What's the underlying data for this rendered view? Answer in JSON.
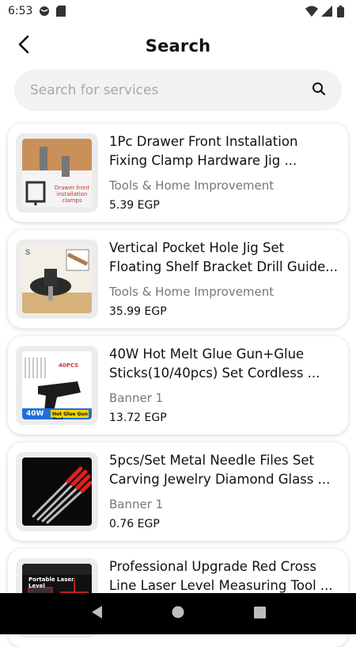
{
  "status_bar": {
    "time": "6:53"
  },
  "header": {
    "title": "Search",
    "back_icon": "arrow-left-icon"
  },
  "search": {
    "placeholder": "Search for services",
    "value": "",
    "icon": "search-icon"
  },
  "products": [
    {
      "title": "1Pc Drawer Front Installation Fixing Clamp Hardware Jig ...",
      "category": "Tools & Home Improvement",
      "price": "5.39 EGP",
      "image_caption": "Drawer front installation clamps"
    },
    {
      "title": "Vertical Pocket Hole Jig Set Floating Shelf Bracket Drill Guide...",
      "category": "Tools & Home Improvement",
      "price": "35.99 EGP"
    },
    {
      "title": "40W Hot Melt Glue Gun+Glue Sticks(10/40pcs) Set Cordless ...",
      "category": "Banner 1",
      "price": "13.72 EGP",
      "image_caption_top": "40PCS",
      "image_badge": "40W",
      "image_caption": "Hot Glue Gun Tool"
    },
    {
      "title": "5pcs/Set  Metal Needle Files Set Carving Jewelry Diamond Glass ...",
      "category": "Banner 1",
      "price": "0.76 EGP"
    },
    {
      "title": "Professional Upgrade Red Cross Line Laser Level Measuring Tool ...",
      "category": "",
      "price": "",
      "image_caption": "Portable Laser Level"
    }
  ],
  "colors": {
    "card_shadow": "#d0d0d0",
    "search_bg": "#f2f2f2",
    "muted_text": "#777777",
    "nav_bar": "#000000"
  }
}
